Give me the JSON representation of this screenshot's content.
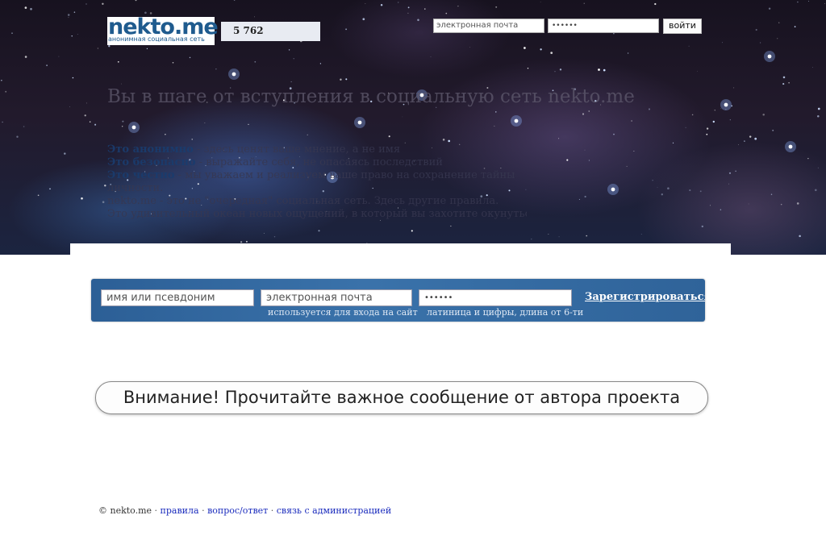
{
  "header": {
    "logo": {
      "name": "nekto.me",
      "tagline": "анонимная социальная сеть"
    },
    "counter": "5 762",
    "login": {
      "email_placeholder": "электронная почта",
      "password_value": "••••••",
      "submit_label": "войти"
    }
  },
  "hero": {
    "title": "Вы в шаге от вступления в социальную сеть nekto.me",
    "lines": [
      {
        "bold": "Это анонимно",
        "rest": " - здесь ценят ваше мнение, а не имя"
      },
      {
        "bold": "Это безопасно",
        "rest": " - выражайте себя, не опасаясь последствий"
      },
      {
        "bold": "Это честно",
        "rest": " - мы уважаем и реализуем ваше право на сохранение тайны"
      },
      {
        "bold": "",
        "rest": "личности."
      },
      {
        "bold": "",
        "rest": "nekto.me - это не \"очередная\" социальная сеть. Здесь другие правила."
      },
      {
        "bold": "",
        "rest": "Это удивительный океан новых ощущений, в который вы захотите окунуться."
      }
    ]
  },
  "registration": {
    "name_placeholder": "имя или псевдоним",
    "email_placeholder": "электронная почта",
    "password_value": "••••••",
    "submit_label": "Зарегистрироваться",
    "email_hint": "используется для входа на сайт",
    "password_hint": "латиница и цифры, длина от 6-ти"
  },
  "notice": "Внимание! Прочитайте важное сообщение от автора проекта",
  "footer": {
    "copyright": "© nekto.me",
    "separator": "·",
    "links": [
      "правила",
      "вопрос/ответ",
      "связь с администрацией"
    ]
  }
}
